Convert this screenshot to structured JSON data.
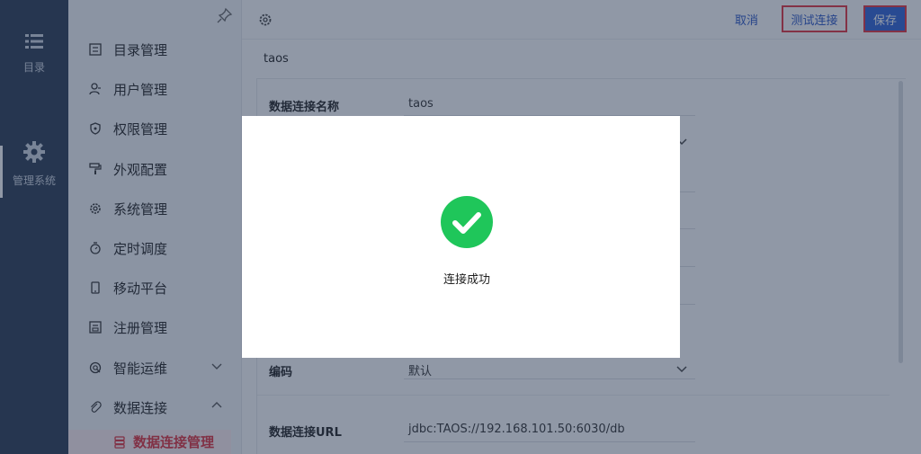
{
  "rail": {
    "items": [
      {
        "label": "目录",
        "icon": "list-icon"
      },
      {
        "label": "管理系统",
        "icon": "gear-icon"
      }
    ]
  },
  "sidebar": {
    "items": [
      {
        "label": "目录管理",
        "icon": "catalog-icon"
      },
      {
        "label": "用户管理",
        "icon": "user-icon"
      },
      {
        "label": "权限管理",
        "icon": "shield-icon"
      },
      {
        "label": "外观配置",
        "icon": "paint-roller-icon"
      },
      {
        "label": "系统管理",
        "icon": "gear-icon"
      },
      {
        "label": "定时调度",
        "icon": "timer-icon"
      },
      {
        "label": "移动平台",
        "icon": "mobile-icon"
      },
      {
        "label": "注册管理",
        "icon": "register-icon"
      },
      {
        "label": "智能运维",
        "icon": "ops-icon"
      },
      {
        "label": "数据连接",
        "icon": "paperclip-icon"
      }
    ],
    "sub_item": {
      "label": "数据连接管理",
      "icon": "database-icon"
    }
  },
  "toolbar": {
    "cancel_label": "取消",
    "test_label": "测试连接",
    "save_label": "保存"
  },
  "connection": {
    "title": "taos",
    "fields": {
      "name_label": "数据连接名称",
      "name_value": "taos",
      "encoding_label": "编码",
      "encoding_value": "默认",
      "url_label": "数据连接URL",
      "url_value": "jdbc:TAOS://192.168.101.50:6030/db"
    }
  },
  "dialog": {
    "message": "连接成功"
  },
  "colors": {
    "accent": "#2f62d6",
    "highlight": "#e5333f",
    "success": "#1fc65a",
    "rail_bg": "#2b3a52"
  }
}
